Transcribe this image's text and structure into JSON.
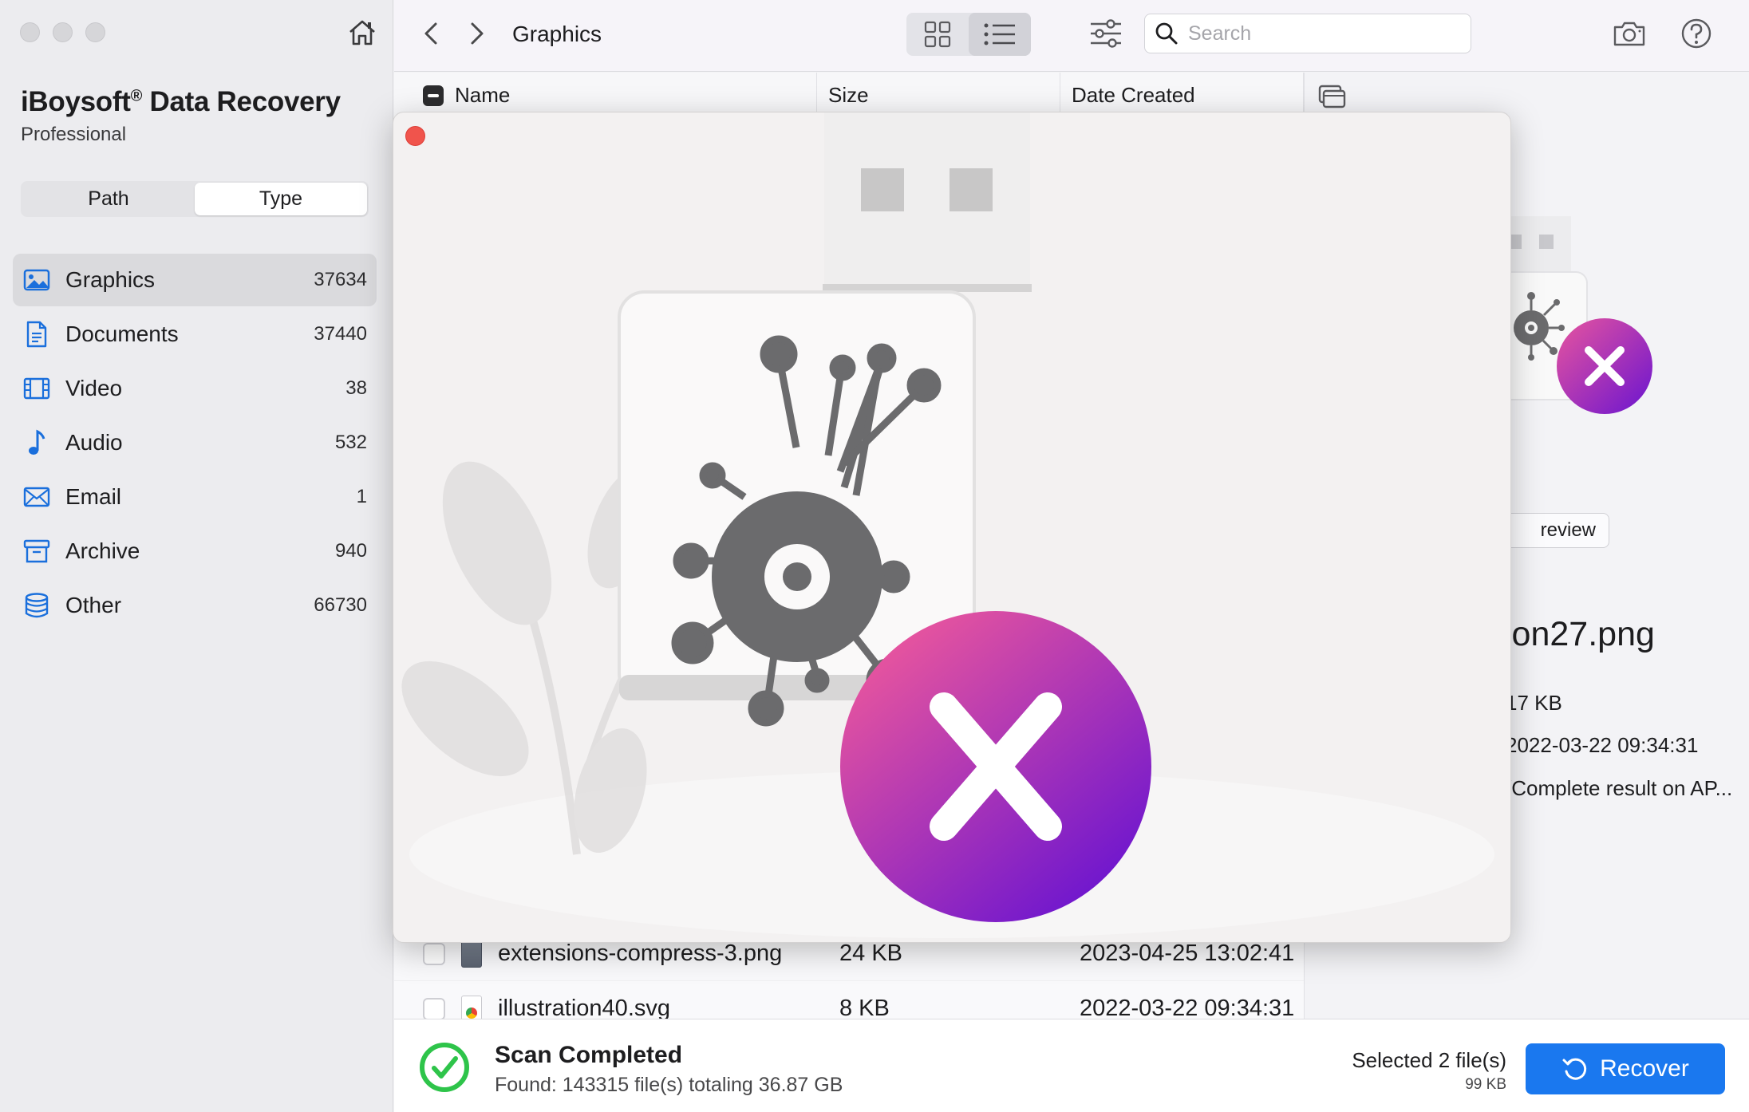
{
  "app": {
    "name": "iBoysoft",
    "registered": "®",
    "name_suffix": " Data Recovery",
    "edition": "Professional"
  },
  "sidebar": {
    "view_tabs": [
      {
        "label": "Path",
        "active": false
      },
      {
        "label": "Type",
        "active": true
      }
    ],
    "categories": [
      {
        "label": "Graphics",
        "count": "37634",
        "icon": "image-icon",
        "selected": true
      },
      {
        "label": "Documents",
        "count": "37440",
        "icon": "document-icon",
        "selected": false
      },
      {
        "label": "Video",
        "count": "38",
        "icon": "film-icon",
        "selected": false
      },
      {
        "label": "Audio",
        "count": "532",
        "icon": "music-note-icon",
        "selected": false
      },
      {
        "label": "Email",
        "count": "1",
        "icon": "envelope-icon",
        "selected": false
      },
      {
        "label": "Archive",
        "count": "940",
        "icon": "archive-box-icon",
        "selected": false
      },
      {
        "label": "Other",
        "count": "66730",
        "icon": "database-icon",
        "selected": false
      }
    ]
  },
  "toolbar": {
    "title": "Graphics",
    "search_placeholder": "Search",
    "view_mode": "list"
  },
  "file_list": {
    "columns": [
      "Name",
      "Size",
      "Date Created"
    ],
    "rows": [
      {
        "name": "extensions-compress-3.png",
        "size": "24 KB",
        "date": "2023-04-25 13:02:41",
        "icon": "png-file-icon"
      },
      {
        "name": "illustration40.svg",
        "size": "8 KB",
        "date": "2022-03-22 09:34:31",
        "icon": "svg-file-icon"
      }
    ]
  },
  "detail": {
    "preview_label": "review",
    "file_name": "ion27.png",
    "file_size": "17 KB",
    "file_date": "2022-03-22 09:34:31",
    "file_path": "/Complete result on AP..."
  },
  "footer": {
    "scan_title": "Scan Completed",
    "scan_summary": "Found: 143315 file(s) totaling 36.87 GB",
    "selected_label": "Selected 2 file(s)",
    "selected_size": "99 KB",
    "recover_label": "Recover"
  },
  "colors": {
    "accent": "#1a78ef",
    "success": "#2ec44a",
    "close_red": "#f0544c",
    "badge_gradient_start": "#e8559e",
    "badge_gradient_end": "#6a14d0"
  }
}
